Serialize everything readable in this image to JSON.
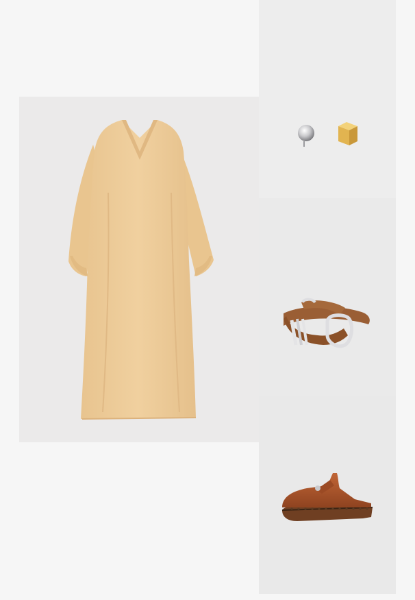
{
  "colors": {
    "page_background": "#f6f6f6",
    "panel_background": "#ebeaea",
    "dress": "#eecc9b",
    "belt": "#9a5e34",
    "clog": "#a8532a",
    "gold": "#e2b450",
    "silver": "#d9d9dc"
  },
  "products": [
    {
      "id": "dress",
      "icon": "dress-image"
    },
    {
      "id": "earrings",
      "icon": "earrings-image"
    },
    {
      "id": "belt",
      "icon": "belt-image"
    },
    {
      "id": "clog",
      "icon": "clog-image"
    }
  ]
}
